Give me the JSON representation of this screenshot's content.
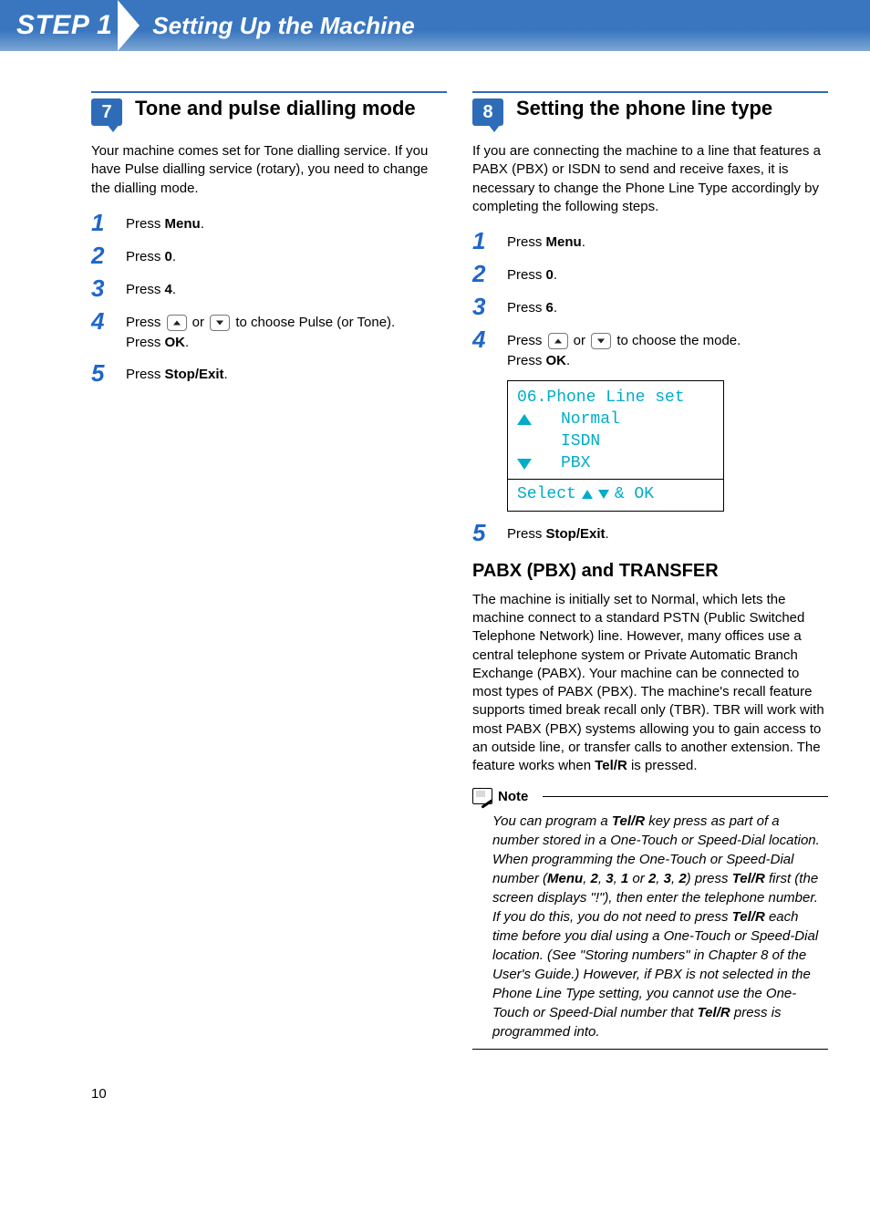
{
  "banner": {
    "step_label": "STEP 1",
    "title": "Setting Up the Machine"
  },
  "section7": {
    "num": "7",
    "title": "Tone and pulse dialling mode",
    "intro": "Your machine comes set for Tone dialling service.  If you have Pulse dialling service  (rotary),  you need to change the dialling mode.",
    "steps": {
      "s1_pre": "Press ",
      "s1_b": "Menu",
      "s2_pre": "Press ",
      "s2_b": "0",
      "s3_pre": "Press ",
      "s3_b": "4",
      "s4_a": "Press ",
      "s4_b": " or ",
      "s4_c": " to choose Pulse (or Tone).",
      "s4_d": "Press ",
      "s4_e": "OK",
      "s5_pre": "Press ",
      "s5_b": "Stop/Exit"
    }
  },
  "section8": {
    "num": "8",
    "title": "Setting the phone line type",
    "intro": "If you are connecting the machine to a line that features a PABX (PBX) or ISDN to send and receive faxes, it is necessary to change the Phone Line Type accordingly by completing the following steps.",
    "steps": {
      "s1_pre": "Press ",
      "s1_b": "Menu",
      "s2_pre": "Press ",
      "s2_b": "0",
      "s3_pre": "Press ",
      "s3_b": "6",
      "s4_a": "Press ",
      "s4_b": " or ",
      "s4_c": " to choose the mode.",
      "s4_d": "Press ",
      "s4_e": "OK",
      "s5_pre": "Press ",
      "s5_b": "Stop/Exit"
    },
    "lcd": {
      "line0": "06.Phone Line set",
      "line1": "Normal",
      "line2": "ISDN",
      "line3": "PBX",
      "footer_a": "Select ",
      "footer_b": " & OK"
    },
    "pabx": {
      "heading": "PABX (PBX) and TRANSFER",
      "body_a": "The machine is initially set to Normal, which lets the machine connect to a standard PSTN (Public Switched Telephone Network) line. However, many offices use a central telephone system or Private Automatic Branch Exchange (PABX). Your machine can be connected to most types of PABX (PBX). The machine's recall feature supports timed break recall only (TBR). TBR will work with most PABX (PBX) systems allowing you to gain access to an outside line, or transfer calls to another extension. The feature works when ",
      "body_b": "Tel/R",
      "body_c": " is pressed."
    },
    "note": {
      "label": "Note",
      "t1": "You can program a ",
      "b1": "Tel/R",
      "t2": " key press as part of a number stored in a One-Touch or Speed-Dial location. When programming the One-Touch or Speed-Dial number (",
      "b2": "Menu",
      "t3": ", ",
      "b3": "2",
      "t4": ", ",
      "b4": "3",
      "t5": ", ",
      "b5": "1",
      "t6": " or ",
      "b6": "2",
      "t7": ", ",
      "b7": "3",
      "t8": ", ",
      "b8": "2",
      "t9": ") press ",
      "b9": "Tel/R",
      "t10": " first (the screen displays \"!\"), then enter the telephone number. If you do this, you do not need to press ",
      "b10": "Tel/R",
      "t11": " each time before you dial using a One-Touch or Speed-Dial location. (See \"Storing numbers\" in Chapter 8 of the User's Guide.) However, if PBX is not selected in the Phone Line Type setting, you cannot use the One-Touch or Speed-Dial number that ",
      "b11": "Tel/R",
      "t12": " press is programmed into."
    }
  },
  "page_num": "10"
}
